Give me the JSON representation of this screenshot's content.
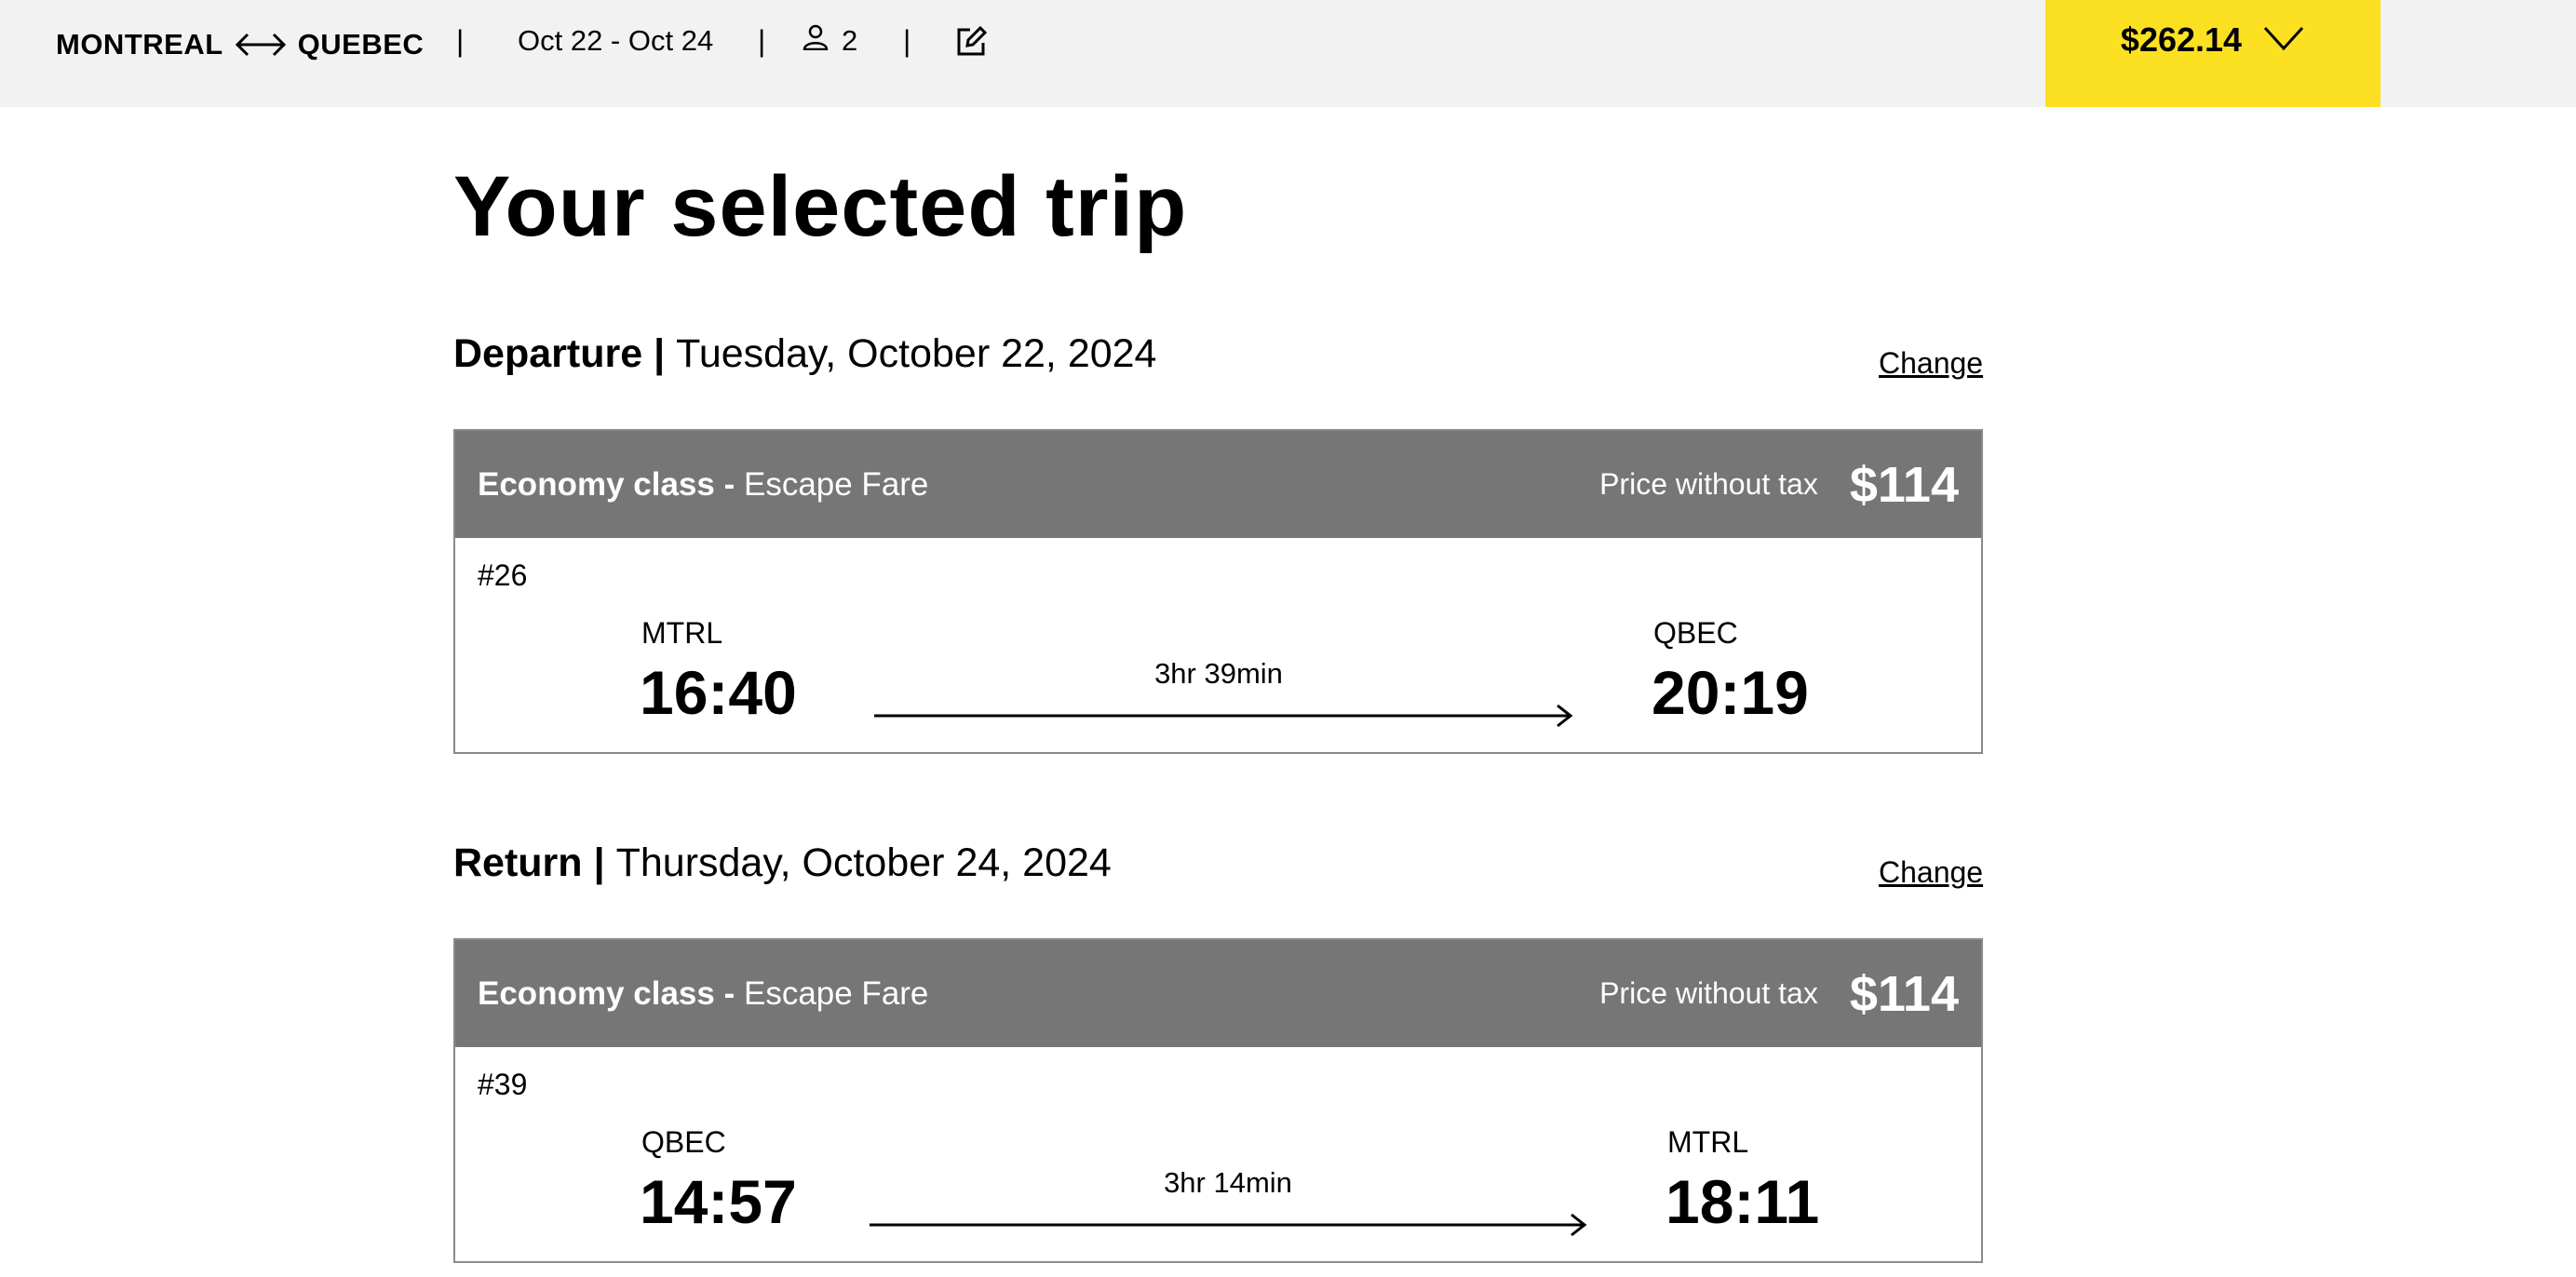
{
  "header": {
    "origin": "MONTREAL",
    "destination": "QUEBEC",
    "route_icon": "double-arrow-icon",
    "separator": "|",
    "dates": "Oct 22 - Oct 24",
    "passenger_icon": "person-icon",
    "passengers": "2",
    "edit_icon": "pencil-edit-icon",
    "total": "$262.14",
    "total_icon": "chevron-down-icon",
    "accent_color": "#fce022",
    "bar_color": "#f2f2f2"
  },
  "page": {
    "title": "Your selected trip"
  },
  "departure": {
    "label": "Departure",
    "sep": "|",
    "date": "Tuesday, October 22, 2024",
    "change": "Change",
    "card": {
      "class_label": "Economy class -",
      "fare": "Escape Fare",
      "price_label": "Price without tax",
      "price": "$114",
      "train": "#26",
      "from_station": "MTRL",
      "from_time": "16:40",
      "duration": "3hr 39min",
      "to_station": "QBEC",
      "to_time": "20:19"
    }
  },
  "return": {
    "label": "Return",
    "sep": "|",
    "date": "Thursday, October 24, 2024",
    "change": "Change",
    "card": {
      "class_label": "Economy class -",
      "fare": "Escape Fare",
      "price_label": "Price without tax",
      "price": "$114",
      "train": "#39",
      "from_station": "QBEC",
      "from_time": "14:57",
      "duration": "3hr 14min",
      "to_station": "MTRL",
      "to_time": "18:11"
    }
  },
  "colors": {
    "card_header": "#767676",
    "card_border": "#8a8a8a"
  }
}
